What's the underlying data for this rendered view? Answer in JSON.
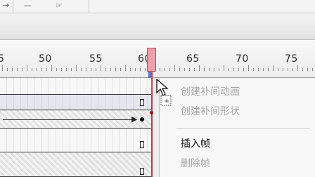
{
  "toolbar": {
    "glyph_a": "→",
    "glyph_b": "—",
    "glyph_c": "☞"
  },
  "ruler": {
    "labels": [
      "5",
      "50",
      "55",
      "60",
      "65",
      "70",
      "75"
    ],
    "current_frame": 61
  },
  "context_menu": {
    "items": [
      {
        "label": "创建补间动画",
        "enabled": false
      },
      {
        "label": "创建补间形状",
        "enabled": false
      },
      {
        "label": "插入帧",
        "enabled": true
      },
      {
        "label": "删除帧",
        "enabled": false
      }
    ]
  },
  "colors": {
    "playhead": "#c4364a",
    "playhead_fill": "#f0a0ac",
    "selection": "#5b76c8",
    "disabled_text": "#a5a5a5"
  }
}
